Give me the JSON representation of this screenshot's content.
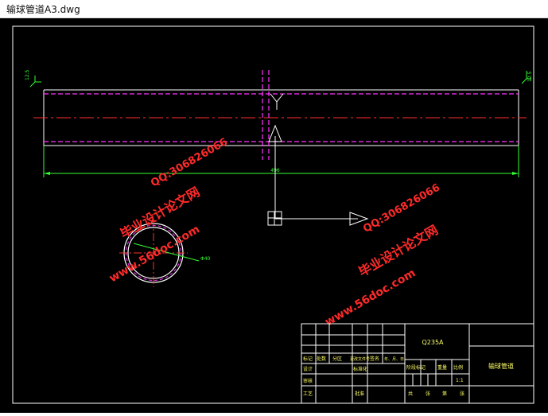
{
  "window": {
    "title": "输球管道A3.dwg"
  },
  "colors": {
    "background": "#000000",
    "frame": "#ffffff",
    "pipe_outline": "#ffffff",
    "hidden_line": "#ff33ff",
    "center_line": "#ff3030",
    "dimension": "#33ff33",
    "watermark": "#ff2a2a"
  },
  "drawing": {
    "dims": {
      "length": "496",
      "roughness_left": "12.5",
      "roughness_right": "12.5",
      "diameter": "Φ40"
    },
    "watermarks": [
      {
        "site": "www.56doc.com",
        "brand": "毕业设计论文网",
        "qq": "QQ:306826066"
      },
      {
        "site": "www.56doc.com",
        "brand": "毕业设计论文网",
        "qq": "QQ:306826066"
      }
    ],
    "title_block": {
      "material": "Q235A",
      "part_name": "输球管道",
      "scale_label": "比例",
      "scale_value": "1:1",
      "mark_label": "阶段标记",
      "weight_label": "重量",
      "row_labels": [
        "标记",
        "处数",
        "分区",
        "更改文件号",
        "签名",
        "年、月、日"
      ],
      "designer": "设计",
      "standardization": "标准化",
      "reviewer": "审核",
      "process": "工艺",
      "approve": "批准",
      "sheets": [
        "共",
        "张",
        "第",
        "张"
      ]
    }
  }
}
